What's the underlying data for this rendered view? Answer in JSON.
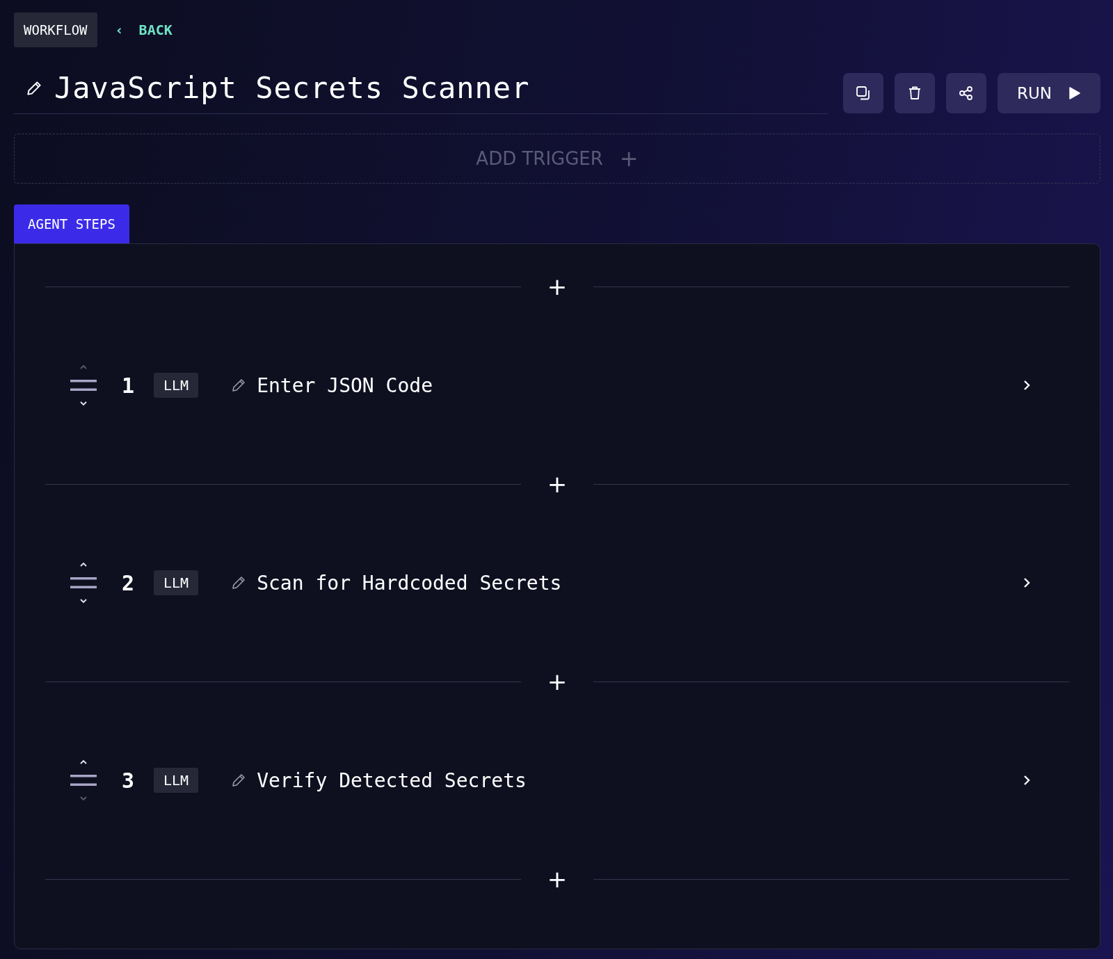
{
  "header": {
    "badge": "WORKFLOW",
    "back": {
      "arrow": "‹",
      "label": "BACK"
    }
  },
  "title": "JavaScript Secrets Scanner",
  "actions": {
    "run": "RUN"
  },
  "trigger": {
    "label": "ADD TRIGGER",
    "plus": "+"
  },
  "tabs": [
    {
      "label": "AGENT STEPS",
      "selected": true
    }
  ],
  "insert_plus": "+",
  "steps": [
    {
      "number": "1",
      "type": "LLM",
      "name": "Enter JSON Code",
      "can_move_up": false,
      "can_move_down": true
    },
    {
      "number": "2",
      "type": "LLM",
      "name": "Scan for Hardcoded Secrets",
      "can_move_up": true,
      "can_move_down": true
    },
    {
      "number": "3",
      "type": "LLM",
      "name": "Verify Detected Secrets",
      "can_move_up": true,
      "can_move_down": false
    }
  ]
}
